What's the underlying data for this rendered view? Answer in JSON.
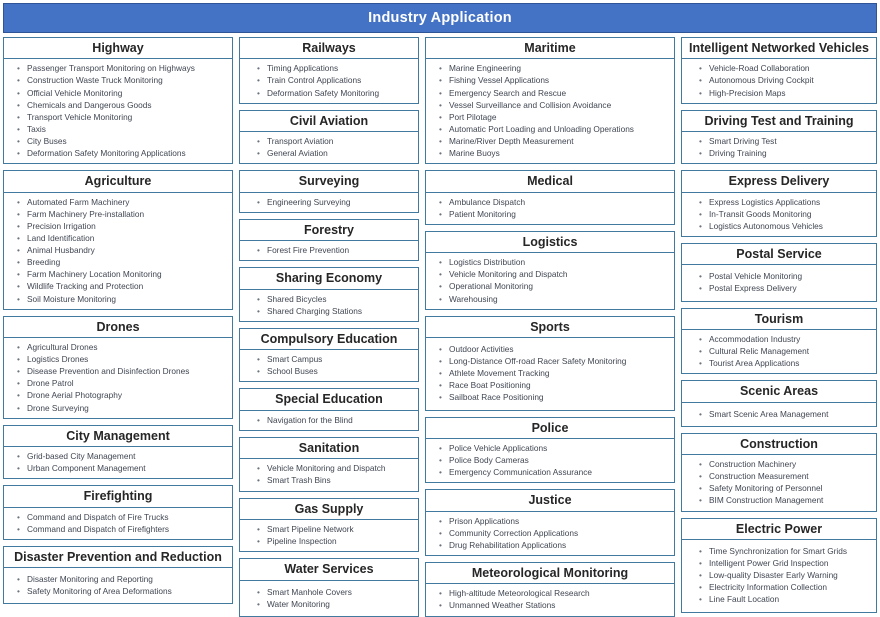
{
  "header": {
    "title": "Industry Application",
    "bg_color": "#4472c4",
    "text_color": "#ffffff"
  },
  "theme": {
    "card_border": "#41799f",
    "heading_color": "#262626",
    "item_color": "#404652",
    "bullet": "•"
  },
  "columns": [
    {
      "id": "column-1",
      "cards": [
        {
          "title": "Highway",
          "items": [
            "Passenger Transport Monitoring on Highways",
            "Construction Waste Truck Monitoring",
            "Official Vehicle Monitoring",
            "Chemicals and Dangerous Goods",
            "Transport Vehicle Monitoring",
            "Taxis",
            "City Buses",
            "Deformation Safety Monitoring Applications"
          ]
        },
        {
          "title": "Agriculture",
          "items": [
            "Automated Farm Machinery",
            "Farm Machinery Pre-installation",
            "Precision Irrigation",
            "Land Identification",
            "Animal Husbandry",
            "Breeding",
            "Farm Machinery Location Monitoring",
            "Wildlife Tracking and Protection",
            "Soil Moisture Monitoring"
          ]
        },
        {
          "title": "Drones",
          "items": [
            "Agricultural Drones",
            "Logistics Drones",
            "Disease Prevention and Disinfection Drones",
            "Drone Patrol",
            "Drone Aerial Photography",
            "Drone Surveying"
          ]
        },
        {
          "title": "City Management",
          "items": [
            "Grid-based City Management",
            "Urban Component Management"
          ]
        },
        {
          "title": "Firefighting",
          "items": [
            "Command and Dispatch of Fire Trucks",
            "Command and Dispatch of Firefighters"
          ]
        },
        {
          "title": "Disaster Prevention and Reduction",
          "items": [
            "Disaster Monitoring and Reporting",
            "Safety Monitoring of Area Deformations"
          ]
        }
      ]
    },
    {
      "id": "column-2",
      "cards": [
        {
          "title": "Railways",
          "items": [
            "Timing Applications",
            "Train Control Applications",
            "Deformation Safety Monitoring"
          ]
        },
        {
          "title": "Civil Aviation",
          "items": [
            "Transport Aviation",
            "General Aviation"
          ]
        },
        {
          "title": "Surveying",
          "items": [
            "Engineering Surveying"
          ]
        },
        {
          "title": "Forestry",
          "items": [
            "Forest Fire Prevention"
          ]
        },
        {
          "title": "Sharing Economy",
          "items": [
            "Shared Bicycles",
            "Shared Charging Stations"
          ]
        },
        {
          "title": "Compulsory Education",
          "items": [
            "Smart Campus",
            "School Buses"
          ]
        },
        {
          "title": "Special Education",
          "items": [
            "Navigation for the Blind"
          ]
        },
        {
          "title": "Sanitation",
          "items": [
            "Vehicle Monitoring and Dispatch",
            "Smart Trash Bins"
          ]
        },
        {
          "title": "Gas Supply",
          "items": [
            "Smart Pipeline Network",
            "Pipeline Inspection"
          ]
        },
        {
          "title": "Water Services",
          "items": [
            "Smart Manhole Covers",
            "Water Monitoring"
          ]
        }
      ]
    },
    {
      "id": "column-3",
      "cards": [
        {
          "title": "Maritime",
          "items": [
            "Marine Engineering",
            "Fishing Vessel Applications",
            "Emergency Search and Rescue",
            "Vessel Surveillance and Collision Avoidance",
            "Port Pilotage",
            "Automatic Port Loading and Unloading Operations",
            "Marine/River Depth Measurement",
            "Marine Buoys"
          ]
        },
        {
          "title": "Medical",
          "items": [
            "Ambulance Dispatch",
            "Patient Monitoring"
          ]
        },
        {
          "title": "Logistics",
          "items": [
            "Logistics Distribution",
            "Vehicle Monitoring and Dispatch",
            "Operational Monitoring",
            "Warehousing"
          ]
        },
        {
          "title": "Sports",
          "items": [
            "Outdoor Activities",
            "Long-Distance Off-road Racer Safety Monitoring",
            "Athlete Movement Tracking",
            "Race Boat Positioning",
            "Sailboat Race Positioning"
          ]
        },
        {
          "title": "Police",
          "items": [
            "Police Vehicle Applications",
            "Police Body Cameras",
            "Emergency Communication Assurance"
          ]
        },
        {
          "title": "Justice",
          "items": [
            "Prison Applications",
            "Community Correction Applications",
            "Drug Rehabilitation Applications"
          ]
        },
        {
          "title": "Meteorological Monitoring",
          "items": [
            "High-altitude Meteorological Research",
            "Unmanned Weather Stations"
          ]
        }
      ]
    },
    {
      "id": "column-4",
      "cards": [
        {
          "title": "Intelligent Networked Vehicles",
          "items": [
            "Vehicle-Road Collaboration",
            "Autonomous Driving Cockpit",
            "High-Precision Maps"
          ]
        },
        {
          "title": "Driving Test and Training",
          "items": [
            "Smart Driving Test",
            "Driving Training"
          ]
        },
        {
          "title": "Express Delivery",
          "items": [
            "Express Logistics Applications",
            "In-Transit Goods Monitoring",
            "Logistics Autonomous Vehicles"
          ]
        },
        {
          "title": "Postal Service",
          "items": [
            "Postal Vehicle Monitoring",
            "Postal Express Delivery"
          ]
        },
        {
          "title": "Tourism",
          "items": [
            "Accommodation Industry",
            "Cultural Relic Management",
            "Tourist Area Applications"
          ]
        },
        {
          "title": "Scenic Areas",
          "items": [
            "Smart Scenic Area Management"
          ]
        },
        {
          "title": "Construction",
          "items": [
            "Construction Machinery",
            "Construction Measurement",
            "Safety Monitoring of Personnel",
            "BIM Construction Management"
          ]
        },
        {
          "title": "Electric Power",
          "items": [
            "Time Synchronization for Smart Grids",
            "Intelligent Power Grid Inspection",
            "Low-quality Disaster Early Warning",
            "Electricity Information Collection",
            "Line Fault Location"
          ]
        }
      ]
    }
  ]
}
